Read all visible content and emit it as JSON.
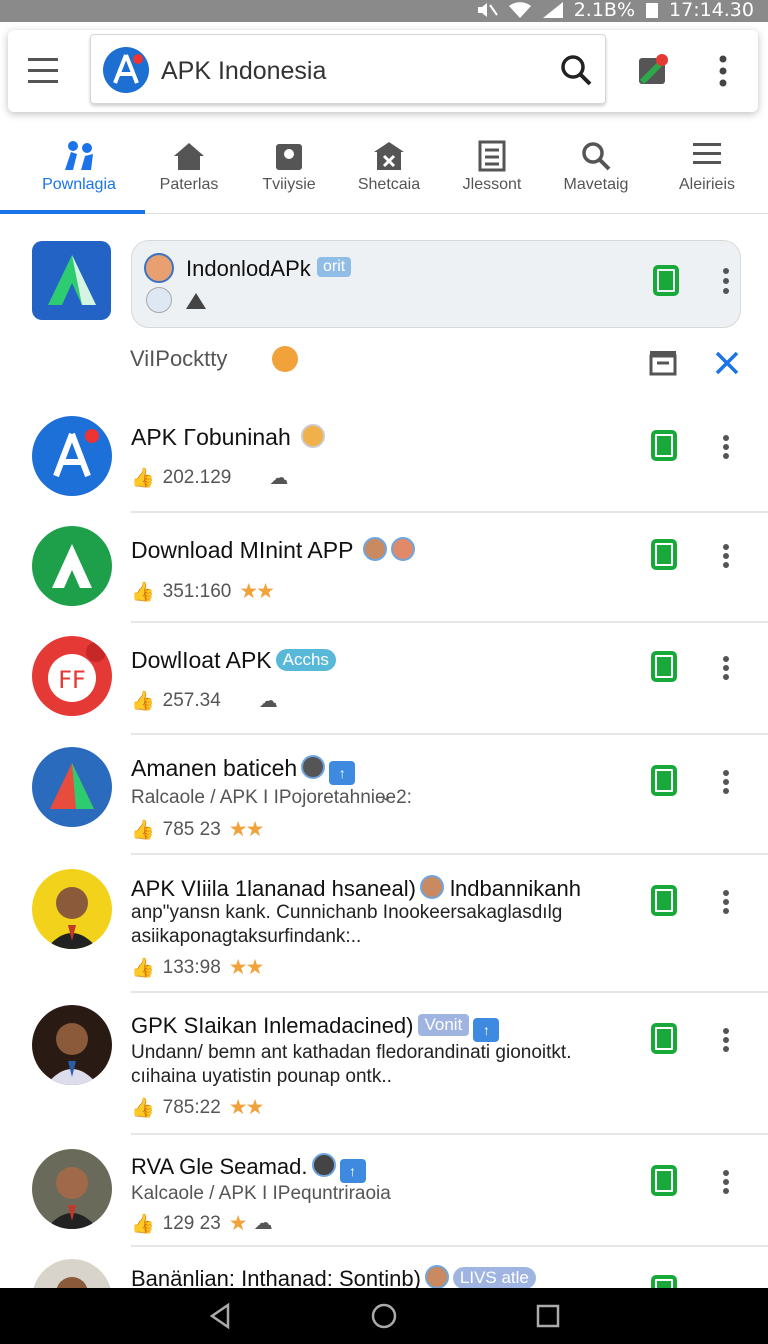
{
  "status_bar": {
    "battery": "2.1B%",
    "time": "17:14.30"
  },
  "search": {
    "title": "APK Indonesia"
  },
  "tabs": [
    {
      "label": "Pownlagia",
      "icon": "people-icon",
      "active": true
    },
    {
      "label": "Paterlas",
      "icon": "home-icon"
    },
    {
      "label": "Tviiysie",
      "icon": "map-pin-icon"
    },
    {
      "label": "Shetcaia",
      "icon": "store-icon"
    },
    {
      "label": "Jlessont",
      "icon": "document-icon"
    },
    {
      "label": "Mavetaig",
      "icon": "search-icon"
    },
    {
      "label": "Aleirieis",
      "icon": "menu-icon"
    }
  ],
  "featured": {
    "title": "IndonlodAPk",
    "badge": "orit"
  },
  "promo": {
    "text": "ViIPocktty"
  },
  "apps": [
    {
      "title": "APK Γobuninah",
      "stats": "202.129",
      "rating_icon": "cloud-icon"
    },
    {
      "title": "Download MInint APP",
      "stats": "351:160",
      "stars": "★★"
    },
    {
      "title": "DowlIoat APK",
      "badge": "Acchs",
      "stats": "257.34",
      "rating_icon": "cloud-icon"
    },
    {
      "title": "Amanen baticeh",
      "sub": "Ralcaole / APK I IPojoretahnie̴e2:",
      "stats": "785 23",
      "stars": "★★"
    },
    {
      "title": "APK VIiila 1lananad hsaneal)",
      "title_suffix": "Ɩndbannikanh",
      "desc": "anp\"yansn kank. Cunnichanb Inookeersakaglasdılg asiikaponagtaksurfindank:..",
      "stats": "133:98",
      "stars": "★★"
    },
    {
      "title": "GPK SIaikan Inlemadacined)",
      "badge": "Vonit",
      "desc": "Undann/ bemn ant kathadan fledorandinati gionoitkt. cıihaina uyatistin pounap ontk..",
      "stats": "785:22",
      "stars": "★★"
    },
    {
      "title": "RVA Gle Seamad.",
      "sub": "Kalcaole / APK I IPequntriraoia",
      "stats": "129 23",
      "stars": "★"
    },
    {
      "title": "Banänlian: Inthanad: Sontinb)",
      "badge": "LIVS atle"
    }
  ],
  "colors": {
    "accent": "#1a73e8",
    "download": "#19a83a",
    "star": "#f2a23a"
  }
}
